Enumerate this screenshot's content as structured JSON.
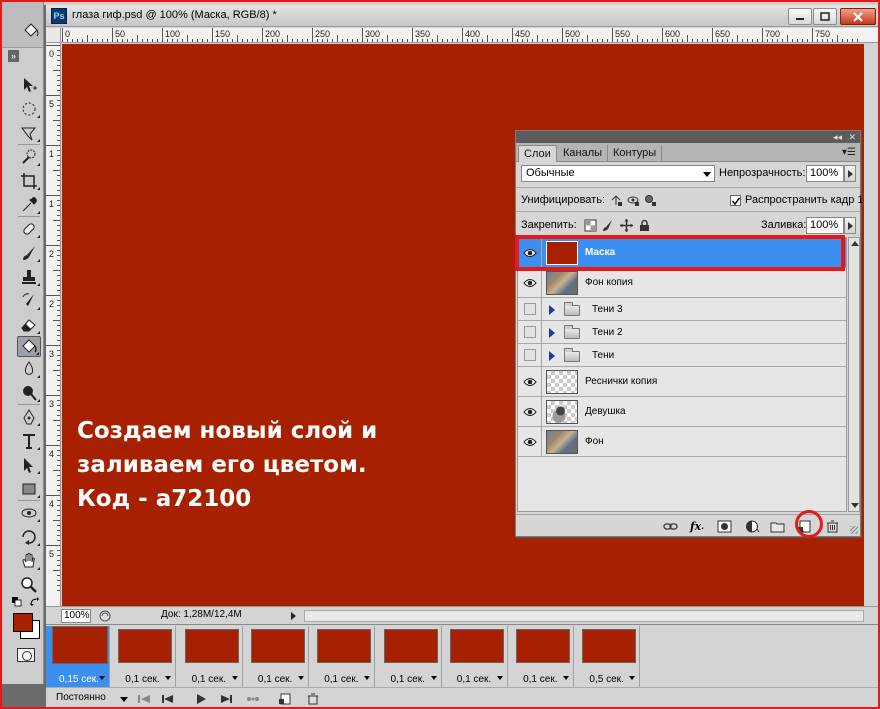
{
  "document": {
    "title": "глаза гиф.psd @ 100% (Маска, RGB/8) *",
    "app_icon": "Ps",
    "canvas_color": "#a72100"
  },
  "rulers": {
    "top_labels": [
      "0",
      "50",
      "100",
      "150",
      "200",
      "250",
      "300",
      "350",
      "400",
      "450",
      "500",
      "550",
      "600",
      "650",
      "700",
      "750"
    ],
    "left_labels": [
      "0",
      "5",
      "1",
      "1",
      "2",
      "2",
      "3",
      "3",
      "4",
      "4",
      "5"
    ]
  },
  "instruction": {
    "line1": "Создаем новый слой и",
    "line2": "заливаем его цветом.",
    "line3": "Код -  a72100"
  },
  "status": {
    "zoom": "100%",
    "doc_info": "Док: 1,28M/12,4M"
  },
  "layers_panel": {
    "tabs": [
      "Слои",
      "Каналы",
      "Контуры"
    ],
    "blend_mode": "Обычные",
    "opacity_label": "Непрозрачность:",
    "opacity_value": "100%",
    "unify_label": "Унифицировать:",
    "propagate_label": "Распространить кадр 1",
    "lock_label": "Закрепить:",
    "fill_label": "Заливка:",
    "fill_value": "100%",
    "layers": [
      {
        "name": "Маска",
        "type": "layer",
        "thumb": "red",
        "visible": true,
        "selected": true
      },
      {
        "name": "Фон копия",
        "type": "layer",
        "thumb": "photo",
        "visible": true,
        "selected": false
      },
      {
        "name": "Тени 3",
        "type": "group",
        "visible": false,
        "selected": false
      },
      {
        "name": "Тени 2",
        "type": "group",
        "visible": false,
        "selected": false
      },
      {
        "name": "Тени",
        "type": "group",
        "visible": false,
        "selected": false
      },
      {
        "name": "Реснички копия",
        "type": "layer",
        "thumb": "checker",
        "visible": true,
        "selected": false
      },
      {
        "name": "Девушка",
        "type": "layer",
        "thumb": "girl",
        "visible": true,
        "selected": false
      },
      {
        "name": "Фон",
        "type": "layer",
        "thumb": "photo",
        "visible": true,
        "selected": false
      }
    ],
    "footer_icons": [
      "link-layers-icon",
      "fx-icon",
      "add-mask-icon",
      "adjustment-layer-icon",
      "new-group-icon",
      "new-layer-icon",
      "delete-layer-icon"
    ]
  },
  "animation": {
    "frames": [
      {
        "delay": "0,15 сек.",
        "selected": true
      },
      {
        "delay": "0,1 сек.",
        "selected": false
      },
      {
        "delay": "0,1 сек.",
        "selected": false
      },
      {
        "delay": "0,1 сек.",
        "selected": false
      },
      {
        "delay": "0,1 сек.",
        "selected": false
      },
      {
        "delay": "0,1 сек.",
        "selected": false
      },
      {
        "delay": "0,1 сек.",
        "selected": false
      },
      {
        "delay": "0,1 сек.",
        "selected": false
      },
      {
        "delay": "0,5 сек.",
        "selected": false
      }
    ],
    "loop": "Постоянно"
  },
  "colors": {
    "foreground": "#a72100",
    "background": "#ffffff",
    "highlight": "#e81818",
    "selection_blue": "#3b8ff0"
  }
}
